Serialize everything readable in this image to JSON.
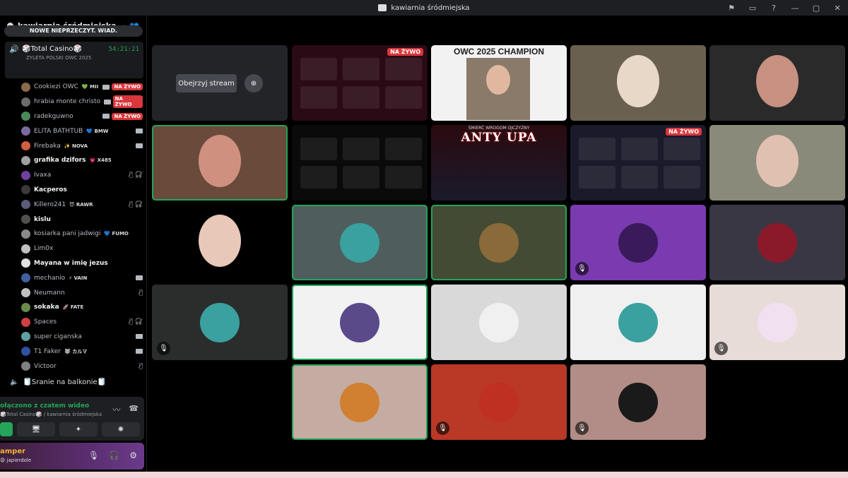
{
  "window": {
    "title": "kawiarnia śródmiejska",
    "controls": [
      "⚑",
      "▭",
      "?",
      "—",
      "▢",
      "✕"
    ]
  },
  "server": {
    "name": "kawiarnia śródmiejska"
  },
  "unread_banner": "NOWE NIEPRZECZYT. WIAD.",
  "voice_channel": {
    "name": "🎲Total Casino🎲",
    "timer": "54:21:21",
    "subtitle": "ZYLETA POLSKI OWC 2025"
  },
  "members": [
    {
      "name": "Cookiezi OWC",
      "tag": "💚 MII",
      "live": "NA ŻYWO",
      "cam": true,
      "bold": false,
      "color": "#8a6b4a"
    },
    {
      "name": "hrabia monte christo",
      "tag": "",
      "live": "NA ŻYWO",
      "cam": true,
      "bold": false,
      "color": "#6b6b6b"
    },
    {
      "name": "radekguwno",
      "tag": "",
      "live": "NA ŻYWO",
      "cam": true,
      "bold": false,
      "color": "#4a8a5a"
    },
    {
      "name": "ELITA BATHTUB",
      "tag": "💙 BMW",
      "live": "",
      "cam": true,
      "bold": false,
      "color": "#7a6ba0"
    },
    {
      "name": "Firebaka",
      "tag": "✨ NOVA",
      "live": "",
      "cam": true,
      "bold": false,
      "color": "#d06040"
    },
    {
      "name": "grafika dzifors",
      "tag": "💗 X485",
      "live": "",
      "cam": false,
      "bold": true,
      "color": "#a0a0a0"
    },
    {
      "name": "Ivaxa",
      "tag": "",
      "live": "",
      "cam": false,
      "bold": false,
      "muted": "🎙̸ 🎧̸",
      "color": "#7040a0"
    },
    {
      "name": "Kacperos",
      "tag": "",
      "live": "",
      "cam": false,
      "bold": true,
      "color": "#3a3a3a"
    },
    {
      "name": "Killero241",
      "tag": "😈 RAWR",
      "live": "",
      "cam": false,
      "bold": false,
      "muted": "🎙̸ 🎧̸",
      "color": "#5a5a7a"
    },
    {
      "name": "kislu",
      "tag": "",
      "live": "",
      "cam": false,
      "bold": true,
      "color": "#505050"
    },
    {
      "name": "kosiarka pani jadwigi",
      "tag": "💙 FUMO",
      "live": "",
      "cam": false,
      "bold": false,
      "color": "#8a8a8a"
    },
    {
      "name": "Lim0x",
      "tag": "",
      "live": "",
      "cam": false,
      "bold": false,
      "color": "#c0c0c0"
    },
    {
      "name": "Mayana w imię jezus",
      "tag": "",
      "live": "",
      "cam": false,
      "bold": true,
      "color": "#e0e0e0"
    },
    {
      "name": "mechanio",
      "tag": "⚡ VAIN",
      "live": "",
      "cam": true,
      "bold": false,
      "color": "#4060a0"
    },
    {
      "name": "Neumann",
      "tag": "",
      "live": "",
      "cam": false,
      "bold": false,
      "muted": "🎙̸",
      "color": "#c0c0c0"
    },
    {
      "name": "sokaka",
      "tag": "🚀 FATE",
      "live": "",
      "cam": false,
      "bold": true,
      "color": "#6a8a4a"
    },
    {
      "name": "Spaces",
      "tag": "",
      "live": "",
      "cam": false,
      "bold": false,
      "muted": "🎙̸ 🎧̸",
      "color": "#d04040"
    },
    {
      "name": "super ciganska",
      "tag": "",
      "live": "",
      "cam": true,
      "bold": false,
      "color": "#60a0a0"
    },
    {
      "name": "T1 Faker",
      "tag": "🐺 カルマ",
      "live": "",
      "cam": true,
      "bold": false,
      "color": "#3050a0"
    },
    {
      "name": "Victoor",
      "tag": "",
      "live": "",
      "cam": false,
      "bold": false,
      "muted": "🎙̸",
      "color": "#808080"
    }
  ],
  "channel2": "🧻Sranie na balkonie🧻",
  "voice_panel": {
    "status": "ołączono z czatem wideo",
    "sub": "🎲Total Casino🎲 / kawiarnia śródmiejska"
  },
  "user": {
    "name": "amper",
    "status": "😩 japierdole"
  },
  "grid": {
    "watch_stream": "Obejrzyj stream",
    "live_label": "NA ŻYWO",
    "champion_text": "OWC 2025 CHAMPION",
    "anty_text": "ANTY UPA",
    "anty_sub": "ŚMIERĆ WROGOM OJCZYZNY",
    "tiles": [
      {
        "kind": "stream-placeholder"
      },
      {
        "kind": "screen",
        "bg": "#2a0a15",
        "live": true
      },
      {
        "kind": "champion"
      },
      {
        "kind": "cam",
        "bg": "#6a6050",
        "face": "#e8d8c8"
      },
      {
        "kind": "cam",
        "bg": "#2a2a2a",
        "face": "#c89080"
      },
      {
        "kind": "cam",
        "bg": "#6a4a3a",
        "face": "#d09080",
        "speaking": true
      },
      {
        "kind": "screen",
        "bg": "#0a0a0a",
        "live": false
      },
      {
        "kind": "anty"
      },
      {
        "kind": "screen",
        "bg": "#1a1a2a",
        "live": true
      },
      {
        "kind": "cam",
        "bg": "#8a8a7a",
        "face": "#e0c0b0"
      },
      {
        "kind": "photo",
        "bg": "#000000",
        "face": "#e8c8b8"
      },
      {
        "kind": "avatar",
        "bg": "#4f5d5d",
        "ring": "#3aa0a0",
        "speaking": true
      },
      {
        "kind": "avatar",
        "bg": "#434b34",
        "ring": "#8a6a3a",
        "speaking": true
      },
      {
        "kind": "avatar",
        "bg": "#7a3ab0",
        "ring": "#3a1a5a",
        "muted": true
      },
      {
        "kind": "avatar",
        "bg": "#3a3745",
        "ring": "#8a1a2a"
      },
      {
        "kind": "avatar",
        "bg": "#2b2d2d",
        "ring": "#3aa0a0",
        "muted": true
      },
      {
        "kind": "avatar",
        "bg": "#f2f2f2",
        "ring": "#5a4a8a",
        "speaking": true
      },
      {
        "kind": "avatar",
        "bg": "#d9d9d9",
        "ring": "#f0f0f0"
      },
      {
        "kind": "avatar",
        "bg": "#f0f0f0",
        "ring": "#3aa0a0"
      },
      {
        "kind": "avatar",
        "bg": "#e8dcd8",
        "ring": "#f0e0f0",
        "muted": true
      },
      {
        "kind": "avatar",
        "bg": "#c5aca3",
        "ring": "#d08030",
        "speaking": true
      },
      {
        "kind": "avatar",
        "bg": "#b93826",
        "ring": "#c03020",
        "muted": true
      },
      {
        "kind": "avatar",
        "bg": "#b28c86",
        "ring": "#1a1a1a",
        "muted": true
      }
    ]
  }
}
